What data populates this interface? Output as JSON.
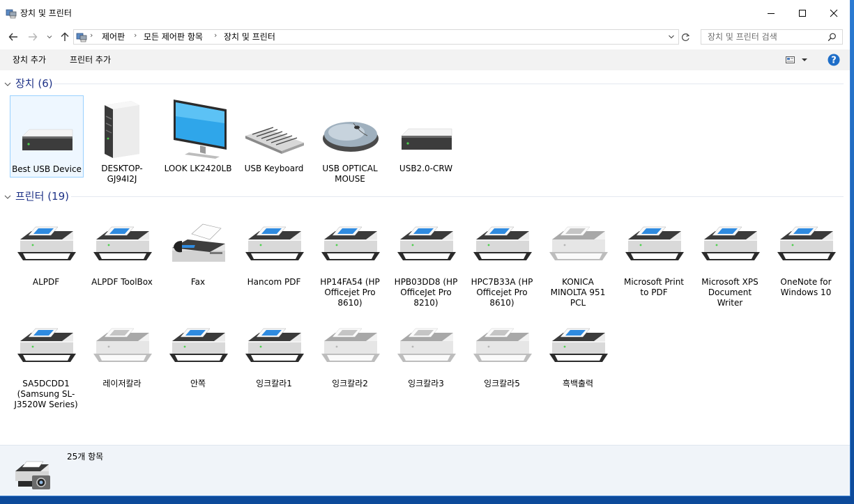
{
  "window": {
    "title": "장치 및 프린터",
    "minimize_icon": "minimize-icon",
    "maximize_icon": "maximize-icon",
    "close_icon": "close-icon"
  },
  "nav": {
    "breadcrumbs": [
      "제어판",
      "모든 제어판 항목",
      "장치 및 프린터"
    ],
    "search_placeholder": "장치 및 프린터 검색"
  },
  "commands": {
    "add_device": "장치 추가",
    "add_printer": "프린터 추가"
  },
  "groups": {
    "devices": {
      "label": "장치",
      "count": "(6)",
      "items": [
        {
          "label": "Best USB Device",
          "icon": "drive-icon"
        },
        {
          "label": "DESKTOP-GJ94I2J",
          "icon": "desktop-tower-icon"
        },
        {
          "label": "LOOK LK2420LB",
          "icon": "monitor-icon"
        },
        {
          "label": "USB Keyboard",
          "icon": "keyboard-icon"
        },
        {
          "label": "USB OPTICAL MOUSE",
          "icon": "mouse-icon"
        },
        {
          "label": "USB2.0-CRW",
          "icon": "drive-icon"
        }
      ]
    },
    "printers": {
      "label": "프린터",
      "count": "(19)",
      "items": [
        {
          "label": "ALPDF",
          "icon": "printer-icon"
        },
        {
          "label": "ALPDF ToolBox",
          "icon": "printer-icon"
        },
        {
          "label": "Fax",
          "icon": "fax-icon"
        },
        {
          "label": "Hancom PDF",
          "icon": "printer-icon"
        },
        {
          "label": "HP14FA54 (HP Officejet Pro 8610)",
          "icon": "printer-icon"
        },
        {
          "label": "HPB03DD8 (HP OfficeJet Pro 8210)",
          "icon": "printer-icon"
        },
        {
          "label": "HPC7B33A (HP Officejet Pro 8610)",
          "icon": "printer-icon"
        },
        {
          "label": "KONICA MINOLTA 951 PCL",
          "icon": "printer-offline-icon"
        },
        {
          "label": "Microsoft Print to PDF",
          "icon": "printer-icon"
        },
        {
          "label": "Microsoft XPS Document Writer",
          "icon": "printer-icon"
        },
        {
          "label": "OneNote for Windows 10",
          "icon": "printer-icon"
        },
        {
          "label": "SA5DCDD1 (Samsung SL-J3520W Series)",
          "icon": "printer-icon"
        },
        {
          "label": "레이저칼라",
          "icon": "printer-offline-icon"
        },
        {
          "label": "안쪽",
          "icon": "printer-icon"
        },
        {
          "label": "잉크칼라1",
          "icon": "printer-icon"
        },
        {
          "label": "잉크칼라2",
          "icon": "printer-offline-icon"
        },
        {
          "label": "잉크칼라3",
          "icon": "printer-offline-icon"
        },
        {
          "label": "잉크칼라5",
          "icon": "printer-offline-icon"
        },
        {
          "label": "흑백출력",
          "icon": "printer-icon"
        }
      ]
    }
  },
  "status": {
    "item_count": "25개 항목",
    "icon": "printer-camera-icon"
  },
  "colors": {
    "accent": "#1e3287",
    "selection_bg": "#eef7ff",
    "selection_border": "#99d1ff",
    "help_blue": "#1e6ec8"
  }
}
